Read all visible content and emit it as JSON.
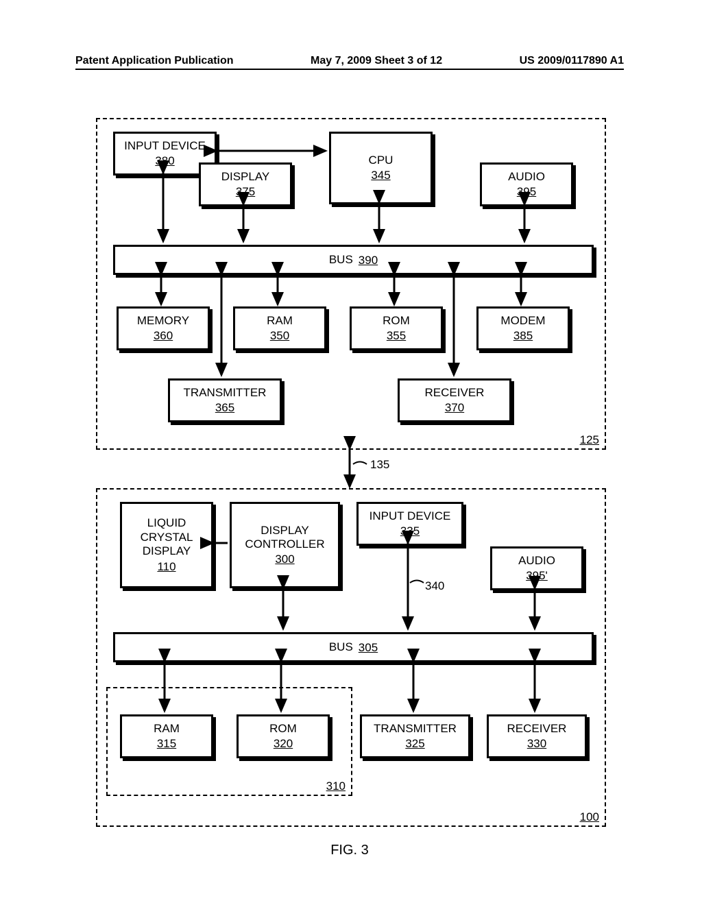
{
  "header": {
    "left": "Patent Application Publication",
    "mid": "May 7, 2009  Sheet 3 of 12",
    "right": "US 2009/0117890 A1"
  },
  "figcaption": "FIG. 3",
  "groups": {
    "top_ref": "125",
    "bottom_ref": "100",
    "mem_ref": "310"
  },
  "labels": {
    "link135": "135",
    "lead340": "340"
  },
  "boxes": {
    "input_top": {
      "label": "INPUT DEVICE",
      "ref": "380"
    },
    "cpu": {
      "label": "CPU",
      "ref": "345"
    },
    "display": {
      "label": "DISPLAY",
      "ref": "375"
    },
    "audio_top": {
      "label": "AUDIO",
      "ref": "395"
    },
    "bus_top": {
      "label": "BUS",
      "ref": "390"
    },
    "memory": {
      "label": "MEMORY",
      "ref": "360"
    },
    "ram_top": {
      "label": "RAM",
      "ref": "350"
    },
    "rom_top": {
      "label": "ROM",
      "ref": "355"
    },
    "modem": {
      "label": "MODEM",
      "ref": "385"
    },
    "tx_top": {
      "label": "TRANSMITTER",
      "ref": "365"
    },
    "rx_top": {
      "label": "RECEIVER",
      "ref": "370"
    },
    "lcd": {
      "label": "LIQUID CRYSTAL DISPLAY",
      "ref": "110"
    },
    "dispctrl": {
      "label": "DISPLAY CONTROLLER",
      "ref": "300"
    },
    "input_bot": {
      "label": "INPUT DEVICE",
      "ref": "335"
    },
    "audio_bot": {
      "label": "AUDIO",
      "ref": "395'"
    },
    "bus_bot": {
      "label": "BUS",
      "ref": "305"
    },
    "ram_bot": {
      "label": "RAM",
      "ref": "315"
    },
    "rom_bot": {
      "label": "ROM",
      "ref": "320"
    },
    "tx_bot": {
      "label": "TRANSMITTER",
      "ref": "325"
    },
    "rx_bot": {
      "label": "RECEIVER",
      "ref": "330"
    }
  }
}
